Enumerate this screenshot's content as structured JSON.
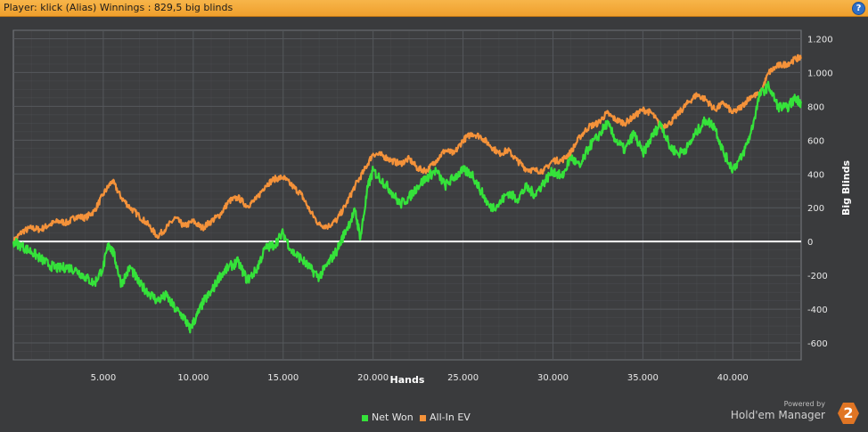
{
  "window": {
    "title": "Player:  klick (Alias) Winnings : 829,5 big blinds",
    "help_icon": "help-icon",
    "help_label": "?"
  },
  "colors": {
    "background": "#3a3b3d",
    "plot_background": "#3d3e40",
    "grid": "#55585c",
    "net_won": "#35e23a",
    "all_in_ev": "#f4923a",
    "zero_line": "#ffffff",
    "titlebar": "#f2a636"
  },
  "brand": {
    "powered_by": "Powered by",
    "name": "Hold'em Manager",
    "logo_number": "2"
  },
  "chart_data": {
    "type": "line",
    "xlabel": "Hands",
    "ylabel": "Big Blinds",
    "xlim": [
      0,
      43800
    ],
    "ylim": [
      -700,
      1250
    ],
    "x_ticks": [
      5000,
      10000,
      15000,
      20000,
      25000,
      30000,
      35000,
      40000
    ],
    "x_tick_labels": [
      "5.000",
      "10.000",
      "15.000",
      "20.000",
      "25.000",
      "30.000",
      "35.000",
      "40.000"
    ],
    "y_ticks": [
      -600,
      -400,
      -200,
      0,
      200,
      400,
      600,
      800,
      1000,
      1200
    ],
    "y_tick_labels": [
      "-600",
      "-400",
      "-200",
      "0",
      "200",
      "400",
      "600",
      "800",
      "1.000",
      "1.200"
    ],
    "grid": true,
    "legend_position": "bottom",
    "series": [
      {
        "name": "Net Won",
        "color": "#35e23a",
        "x": [
          0,
          500,
          1000,
          1500,
          2000,
          2500,
          3000,
          3500,
          4000,
          4500,
          5000,
          5300,
          5600,
          6000,
          6500,
          7000,
          7500,
          8000,
          8500,
          9000,
          9500,
          9800,
          10200,
          10600,
          11000,
          11500,
          12000,
          12500,
          13000,
          13500,
          14000,
          14500,
          15000,
          15500,
          16000,
          16500,
          17000,
          17500,
          18000,
          18500,
          19000,
          19300,
          19700,
          20000,
          20500,
          21000,
          21500,
          22000,
          22500,
          23000,
          23500,
          24000,
          24500,
          25000,
          25500,
          26000,
          26500,
          27000,
          27500,
          28000,
          28500,
          29000,
          29500,
          30000,
          30500,
          31000,
          31500,
          32000,
          32500,
          33000,
          33500,
          34000,
          34500,
          35000,
          35500,
          36000,
          36500,
          37000,
          37500,
          38000,
          38500,
          39000,
          39500,
          40000,
          40500,
          41000,
          41500,
          42000,
          42500,
          43000,
          43500,
          43800
        ],
        "values": [
          0,
          -30,
          -60,
          -100,
          -140,
          -160,
          -150,
          -170,
          -210,
          -250,
          -150,
          -10,
          -80,
          -250,
          -150,
          -250,
          -300,
          -350,
          -320,
          -400,
          -450,
          -520,
          -440,
          -350,
          -300,
          -200,
          -150,
          -120,
          -230,
          -170,
          -40,
          -20,
          50,
          -60,
          -100,
          -160,
          -210,
          -130,
          -50,
          70,
          180,
          20,
          320,
          420,
          360,
          300,
          220,
          260,
          330,
          380,
          420,
          330,
          380,
          420,
          400,
          300,
          200,
          220,
          290,
          250,
          320,
          280,
          350,
          420,
          380,
          500,
          440,
          560,
          620,
          700,
          600,
          540,
          640,
          520,
          620,
          700,
          560,
          520,
          560,
          650,
          720,
          680,
          520,
          430,
          500,
          640,
          870,
          920,
          800,
          790,
          850,
          820
        ]
      },
      {
        "name": "All-In EV",
        "color": "#f4923a",
        "x": [
          0,
          500,
          1000,
          1500,
          2000,
          2500,
          3000,
          3500,
          4000,
          4500,
          5000,
          5500,
          6000,
          6500,
          7000,
          7500,
          8000,
          8500,
          9000,
          9500,
          10000,
          10500,
          11000,
          11500,
          12000,
          12500,
          13000,
          13500,
          14000,
          14500,
          15000,
          15500,
          16000,
          16500,
          17000,
          17500,
          18000,
          18500,
          19000,
          19500,
          20000,
          20500,
          21000,
          21500,
          22000,
          22500,
          23000,
          23500,
          24000,
          24500,
          25000,
          25500,
          26000,
          26500,
          27000,
          27500,
          28000,
          28500,
          29000,
          29500,
          30000,
          30500,
          31000,
          31500,
          32000,
          32500,
          33000,
          33500,
          34000,
          34500,
          35000,
          35500,
          36000,
          36500,
          37000,
          37500,
          38000,
          38500,
          39000,
          39500,
          40000,
          40500,
          41000,
          41500,
          42000,
          42500,
          43000,
          43500,
          43800
        ],
        "values": [
          0,
          60,
          80,
          70,
          100,
          120,
          110,
          150,
          140,
          180,
          280,
          360,
          260,
          200,
          150,
          100,
          30,
          80,
          140,
          90,
          120,
          80,
          120,
          160,
          240,
          260,
          210,
          250,
          330,
          370,
          380,
          330,
          280,
          180,
          100,
          90,
          130,
          220,
          330,
          420,
          520,
          510,
          480,
          460,
          490,
          430,
          420,
          480,
          540,
          520,
          600,
          640,
          620,
          570,
          520,
          540,
          480,
          430,
          420,
          420,
          480,
          480,
          530,
          620,
          680,
          700,
          760,
          720,
          700,
          740,
          780,
          760,
          680,
          700,
          760,
          820,
          870,
          840,
          780,
          820,
          760,
          800,
          860,
          870,
          1000,
          1040,
          1050,
          1080,
          1090
        ]
      }
    ]
  }
}
